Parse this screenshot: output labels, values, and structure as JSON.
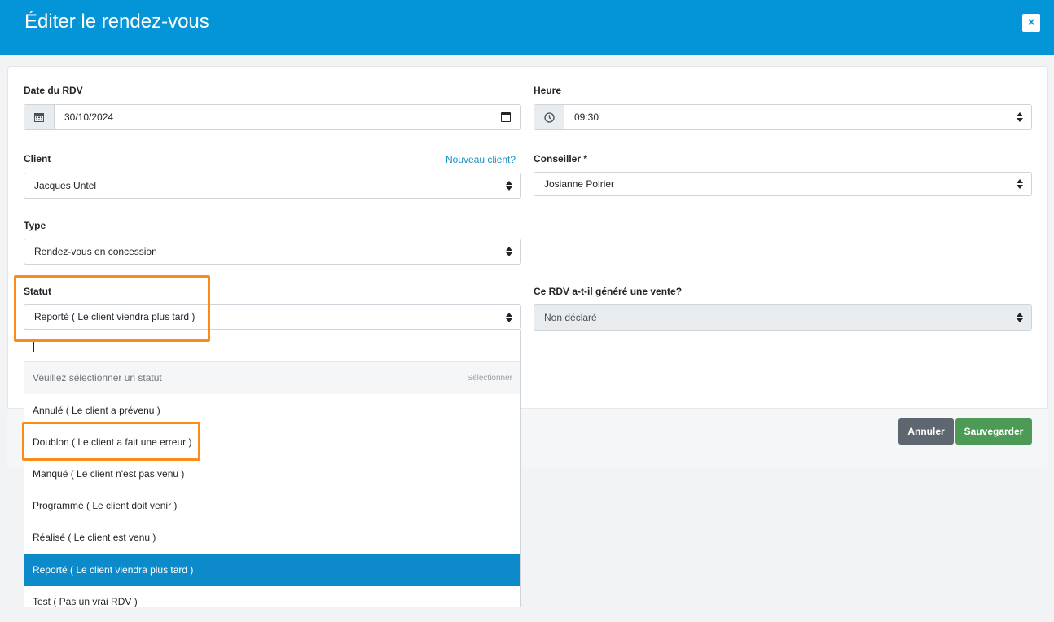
{
  "modal": {
    "title": "Éditer le rendez-vous",
    "close_label": "×"
  },
  "form": {
    "date": {
      "label": "Date du RDV",
      "value": "30/10/2024",
      "icon": "calendar-icon"
    },
    "time": {
      "label": "Heure",
      "value": "09:30",
      "icon": "clock-icon"
    },
    "client": {
      "label": "Client",
      "value": "Jacques Untel",
      "link": "Nouveau client?"
    },
    "advisor": {
      "label": "Conseiller *",
      "value": "Josianne Poirier"
    },
    "type": {
      "label": "Type",
      "value": "Rendez-vous en concession"
    },
    "status": {
      "label": "Statut",
      "value": "Reporté ( Le client viendra plus tard )"
    },
    "sale": {
      "label": "Ce RDV a-t-il généré une vente?",
      "value": "Non déclaré"
    }
  },
  "dropdown": {
    "search_value": "",
    "placeholder": "Veuillez sélectionner un statut",
    "placeholder_hint": "Sélectionner",
    "options": [
      "Annulé ( Le client a prévenu )",
      "Doublon ( Le client a fait une erreur )",
      "Manqué ( Le client n'est pas venu )",
      "Programmé ( Le client doit venir )",
      "Réalisé ( Le client est venu )",
      "Reporté ( Le client viendra plus tard )",
      "Test ( Pas un vrai RDV )"
    ],
    "selected_index": 5
  },
  "buttons": {
    "cancel": "Annuler",
    "save": "Sauvegarder"
  },
  "colors": {
    "header": "#0494d8",
    "highlight": "#fb8c1a",
    "selected_option": "#0d8ac9",
    "save_button": "#4d9a57",
    "cancel_button": "#5e6670"
  }
}
